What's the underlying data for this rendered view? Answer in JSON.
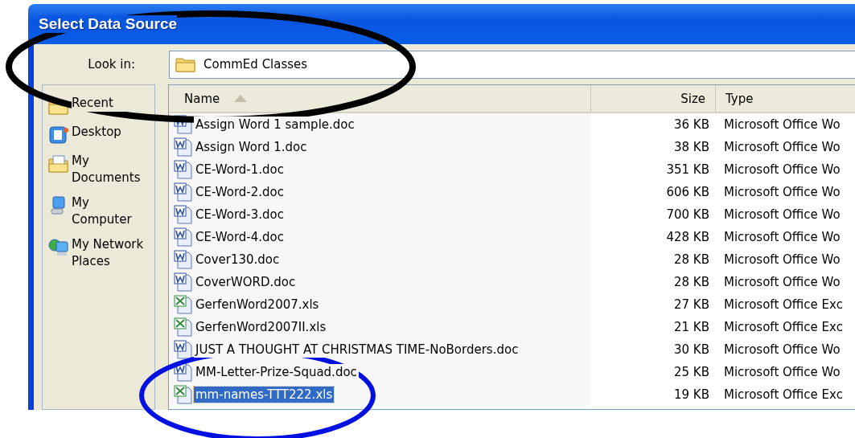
{
  "window": {
    "title": "Select Data Source"
  },
  "look_in": {
    "label": "Look in:",
    "value": "CommEd Classes"
  },
  "sidebar": {
    "items": [
      {
        "label": "Recent",
        "kind": "recent"
      },
      {
        "label": "Desktop",
        "kind": "desktop"
      },
      {
        "label": "My Documents",
        "kind": "documents"
      },
      {
        "label": "My Computer",
        "kind": "computer"
      },
      {
        "label": "My Network Places",
        "kind": "network"
      }
    ]
  },
  "table": {
    "columns": [
      {
        "label": "Name",
        "sorted": true
      },
      {
        "label": "Size",
        "sorted": false
      },
      {
        "label": "Type",
        "sorted": false
      }
    ],
    "rows": [
      {
        "name": "Assign Word 1 sample.doc",
        "size": "36 KB",
        "type": "Microsoft Office Wo",
        "kind": "word",
        "selected": false
      },
      {
        "name": "Assign Word 1.doc",
        "size": "38 KB",
        "type": "Microsoft Office Wo",
        "kind": "word",
        "selected": false
      },
      {
        "name": "CE-Word-1.doc",
        "size": "351 KB",
        "type": "Microsoft Office Wo",
        "kind": "word",
        "selected": false
      },
      {
        "name": "CE-Word-2.doc",
        "size": "606 KB",
        "type": "Microsoft Office Wo",
        "kind": "word",
        "selected": false
      },
      {
        "name": "CE-Word-3.doc",
        "size": "700 KB",
        "type": "Microsoft Office Wo",
        "kind": "word",
        "selected": false
      },
      {
        "name": "CE-Word-4.doc",
        "size": "428 KB",
        "type": "Microsoft Office Wo",
        "kind": "word",
        "selected": false
      },
      {
        "name": "Cover130.doc",
        "size": "28 KB",
        "type": "Microsoft Office Wo",
        "kind": "word",
        "selected": false
      },
      {
        "name": "CoverWORD.doc",
        "size": "28 KB",
        "type": "Microsoft Office Wo",
        "kind": "word",
        "selected": false
      },
      {
        "name": "GerfenWord2007.xls",
        "size": "27 KB",
        "type": "Microsoft Office Exc",
        "kind": "excel",
        "selected": false
      },
      {
        "name": "GerfenWord2007II.xls",
        "size": "21 KB",
        "type": "Microsoft Office Exc",
        "kind": "excel",
        "selected": false
      },
      {
        "name": "JUST A THOUGHT AT CHRISTMAS TIME-NoBorders.doc",
        "size": "30 KB",
        "type": "Microsoft Office Wo",
        "kind": "word",
        "selected": false
      },
      {
        "name": "MM-Letter-Prize-Squad.doc",
        "size": "25 KB",
        "type": "Microsoft Office Wo",
        "kind": "word",
        "selected": false
      },
      {
        "name": "mm-names-TTT222.xls",
        "size": "19 KB",
        "type": "Microsoft Office Exc",
        "kind": "excel",
        "selected": true
      }
    ]
  }
}
